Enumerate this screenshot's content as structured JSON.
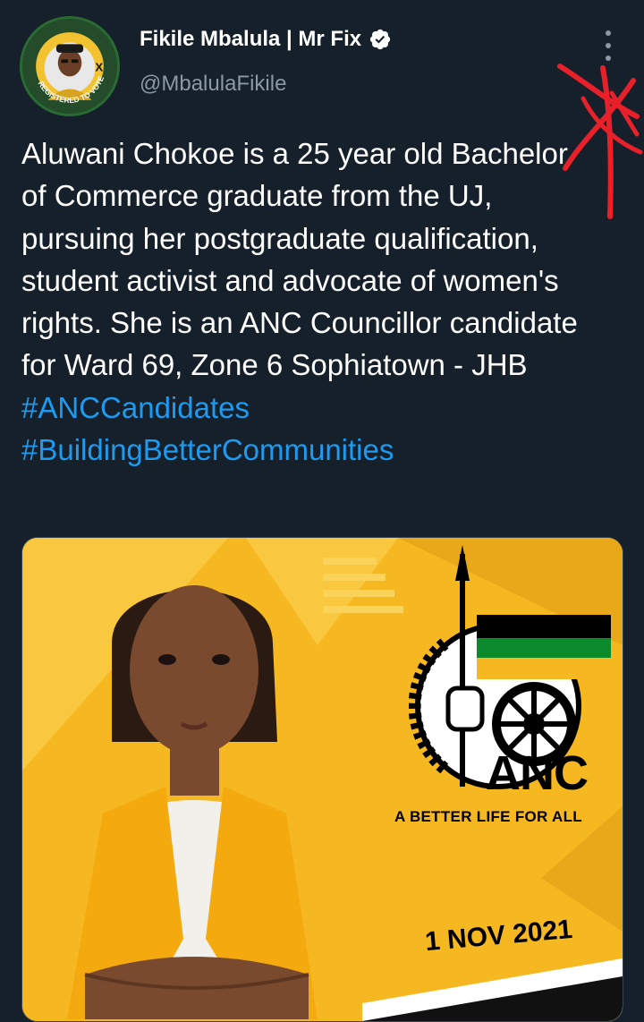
{
  "tweet": {
    "display_name": "Fikile Mbalula | Mr Fix",
    "handle": "@MbalulaFikile",
    "verified": true,
    "text_parts": [
      {
        "type": "text",
        "value": "Aluwani Chokoe is a 25 year old Bachelor of Commerce graduate from the UJ, pursuing her postgraduate qualification, student activist and advocate of women's rights. She is an ANC Councillor candidate for Ward 69, Zone 6 Sophiatown - JHB "
      },
      {
        "type": "hashtag",
        "value": "#ANCCandidates"
      },
      {
        "type": "hashtag",
        "value": "#BuildingBetterCommunities"
      }
    ]
  },
  "avatar_badge": {
    "ring_text": "REGISTERED TO VOTE ANC",
    "x_mark": "X"
  },
  "poster": {
    "party": "ANC",
    "tagline": "A BETTER LIFE FOR ALL",
    "date": "1 NOV 2021"
  },
  "colors": {
    "background": "#15202b",
    "link": "#1d9bf0",
    "secondary_text": "#8b98a5",
    "poster_yellow": "#f6b820",
    "annotation_red": "#e8202a"
  },
  "icons": [
    "verified-badge-icon",
    "more-options-icon"
  ]
}
